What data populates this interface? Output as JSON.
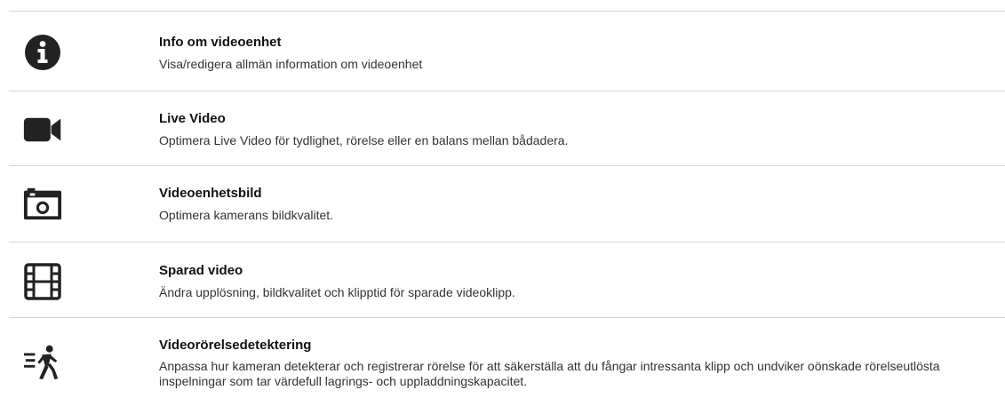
{
  "items": [
    {
      "icon": "info-icon",
      "title": "Info om videoenhet",
      "description": "Visa/redigera allmän information om videoenhet"
    },
    {
      "icon": "video-camera-icon",
      "title": "Live Video",
      "description": "Optimera Live Video för tydlighet, rörelse eller en balans mellan bådadera."
    },
    {
      "icon": "camera-icon",
      "title": "Videoenhetsbild",
      "description": "Optimera kamerans bildkvalitet."
    },
    {
      "icon": "film-icon",
      "title": "Sparad video",
      "description": "Ändra upplösning, bildkvalitet och klipptid för sparade videoklipp."
    },
    {
      "icon": "motion-detection-icon",
      "title": "Videorörelsedetektering",
      "description": "Anpassa hur kameran detekterar och registrerar rörelse för att säkerställa att du fångar intressanta klipp och undviker oönskade rörelseutlösta inspelningar som tar värdefull lagrings- och uppladdningskapacitet."
    }
  ],
  "colors": {
    "icon": "#222222",
    "divider": "#d6d6d6",
    "title": "#111111",
    "description": "#333333"
  }
}
